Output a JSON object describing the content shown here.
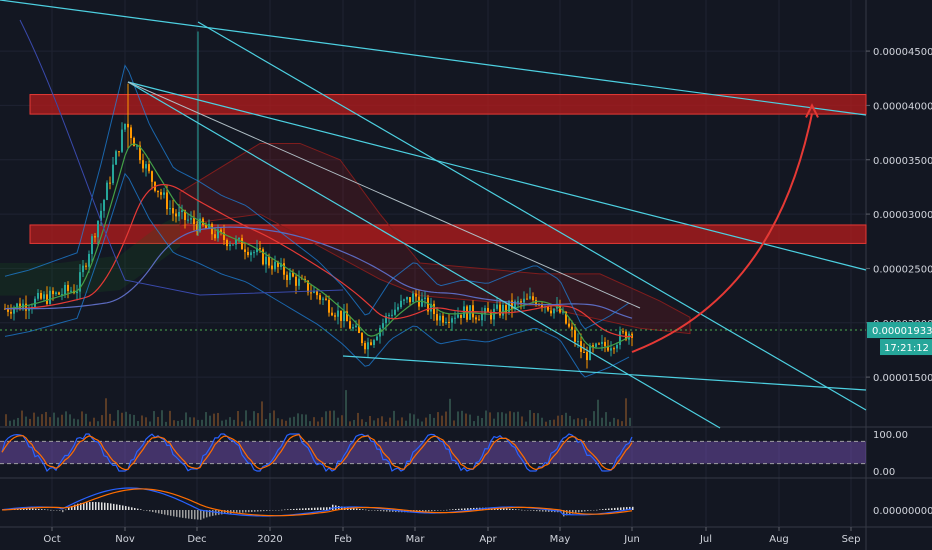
{
  "chart_data": [
    {
      "type": "candlestick",
      "panel": "price",
      "x_ticks": [
        "Oct",
        "Nov",
        "Dec",
        "2020",
        "Feb",
        "Mar",
        "Apr",
        "May",
        "Jun",
        "Jul",
        "Aug",
        "Sep"
      ],
      "y_ticks": [
        "0.00001500",
        "0.00002000",
        "0.00002500",
        "0.00003000",
        "0.00003500",
        "0.00004000",
        "0.00004500"
      ],
      "ylim": [
        1.05e-05,
        4.97e-05
      ],
      "last_price": "0.00001933",
      "countdown": "17:21:12",
      "resistance_zones": [
        {
          "from": 3.92e-05,
          "to": 4.1e-05
        },
        {
          "from": 2.73e-05,
          "to": 2.9e-05
        }
      ],
      "target_price": 4e-05,
      "price_series": {
        "x": [
          "Sep 20",
          "Oct 1",
          "Oct 10",
          "Oct 20",
          "Oct 25",
          "Nov 1",
          "Nov 5",
          "Nov 12",
          "Nov 20",
          "Dec 1",
          "Dec 10",
          "Dec 20",
          "Jan 1",
          "Jan 10",
          "Jan 20",
          "Feb 1",
          "Feb 10",
          "Feb 20",
          "Mar 1",
          "Mar 10",
          "Mar 20",
          "Apr 1",
          "Apr 15",
          "May 1",
          "May 10",
          "May 20",
          "May 31"
        ],
        "close": [
          2.13e-05,
          2.18e-05,
          2.25e-05,
          2.32e-05,
          3.05e-05,
          3.85e-05,
          3.35e-05,
          3e-05,
          2.9e-05,
          2.78e-05,
          2.7e-05,
          2.55e-05,
          2.4e-05,
          2.25e-05,
          2.05e-05,
          1.8e-05,
          2.1e-05,
          2.25e-05,
          2.05e-05,
          2.1e-05,
          2.07e-05,
          2.15e-05,
          2.22e-05,
          2.1e-05,
          1.7e-05,
          1.8e-05,
          1.93e-05
        ]
      },
      "colors": {
        "up": "#26a69a",
        "down": "#ff9800",
        "trendline": "#4dd0e1",
        "zone": "#b71c1c",
        "arrow": "#e53935",
        "last_price": "#4caf50"
      }
    },
    {
      "type": "line",
      "panel": "stoch_rsi",
      "y_ticks": [
        "100.00",
        "0.00"
      ],
      "ylim": [
        0,
        100
      ],
      "band": [
        20,
        80
      ],
      "colors": {
        "k": "#2962ff",
        "d": "#ff6d00",
        "band": "#7e57c2"
      }
    },
    {
      "type": "line",
      "panel": "macd",
      "y_ticks": [
        "0.00000000"
      ],
      "colors": {
        "macd": "#2962ff",
        "signal": "#ff6d00"
      }
    }
  ]
}
